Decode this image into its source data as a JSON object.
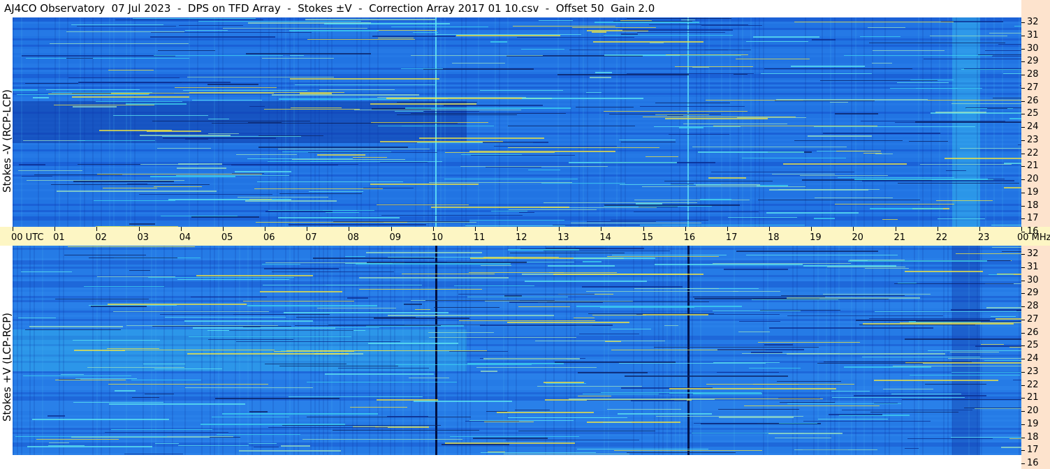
{
  "title": "AJ4CO Observatory  07 Jul 2023  -  DPS on TFD Array  -  Stokes ±V  -  Correction Array 2017 01 10.csv  -  Offset 50  Gain 2.0",
  "top_panel": {
    "ylabel": "Stokes -V (RCP-LCP)"
  },
  "bottom_panel": {
    "ylabel": "Stokes +V (LCP-RCP)"
  },
  "time_axis": {
    "labels": [
      "00 UTC",
      "01",
      "02",
      "03",
      "04",
      "05",
      "06",
      "07",
      "08",
      "09",
      "10",
      "11",
      "12",
      "13",
      "14",
      "15",
      "16",
      "17",
      "18",
      "19",
      "20",
      "21",
      "22",
      "23",
      "00 MHz"
    ]
  },
  "freq_axis": {
    "labels": [
      "32",
      "31",
      "30",
      "29",
      "28",
      "27",
      "26",
      "25",
      "24",
      "23",
      "22",
      "21",
      "20",
      "19",
      "18",
      "17",
      "16"
    ]
  },
  "colors": {
    "background_blue": "#1e6fe0",
    "dark_blue": "#0a2a8c",
    "cyan": "#3fd6f0",
    "yellow": "#f2e640",
    "time_axis_bg": "#fdf6c4",
    "freq_axis_bg": "#fde3cd"
  }
}
